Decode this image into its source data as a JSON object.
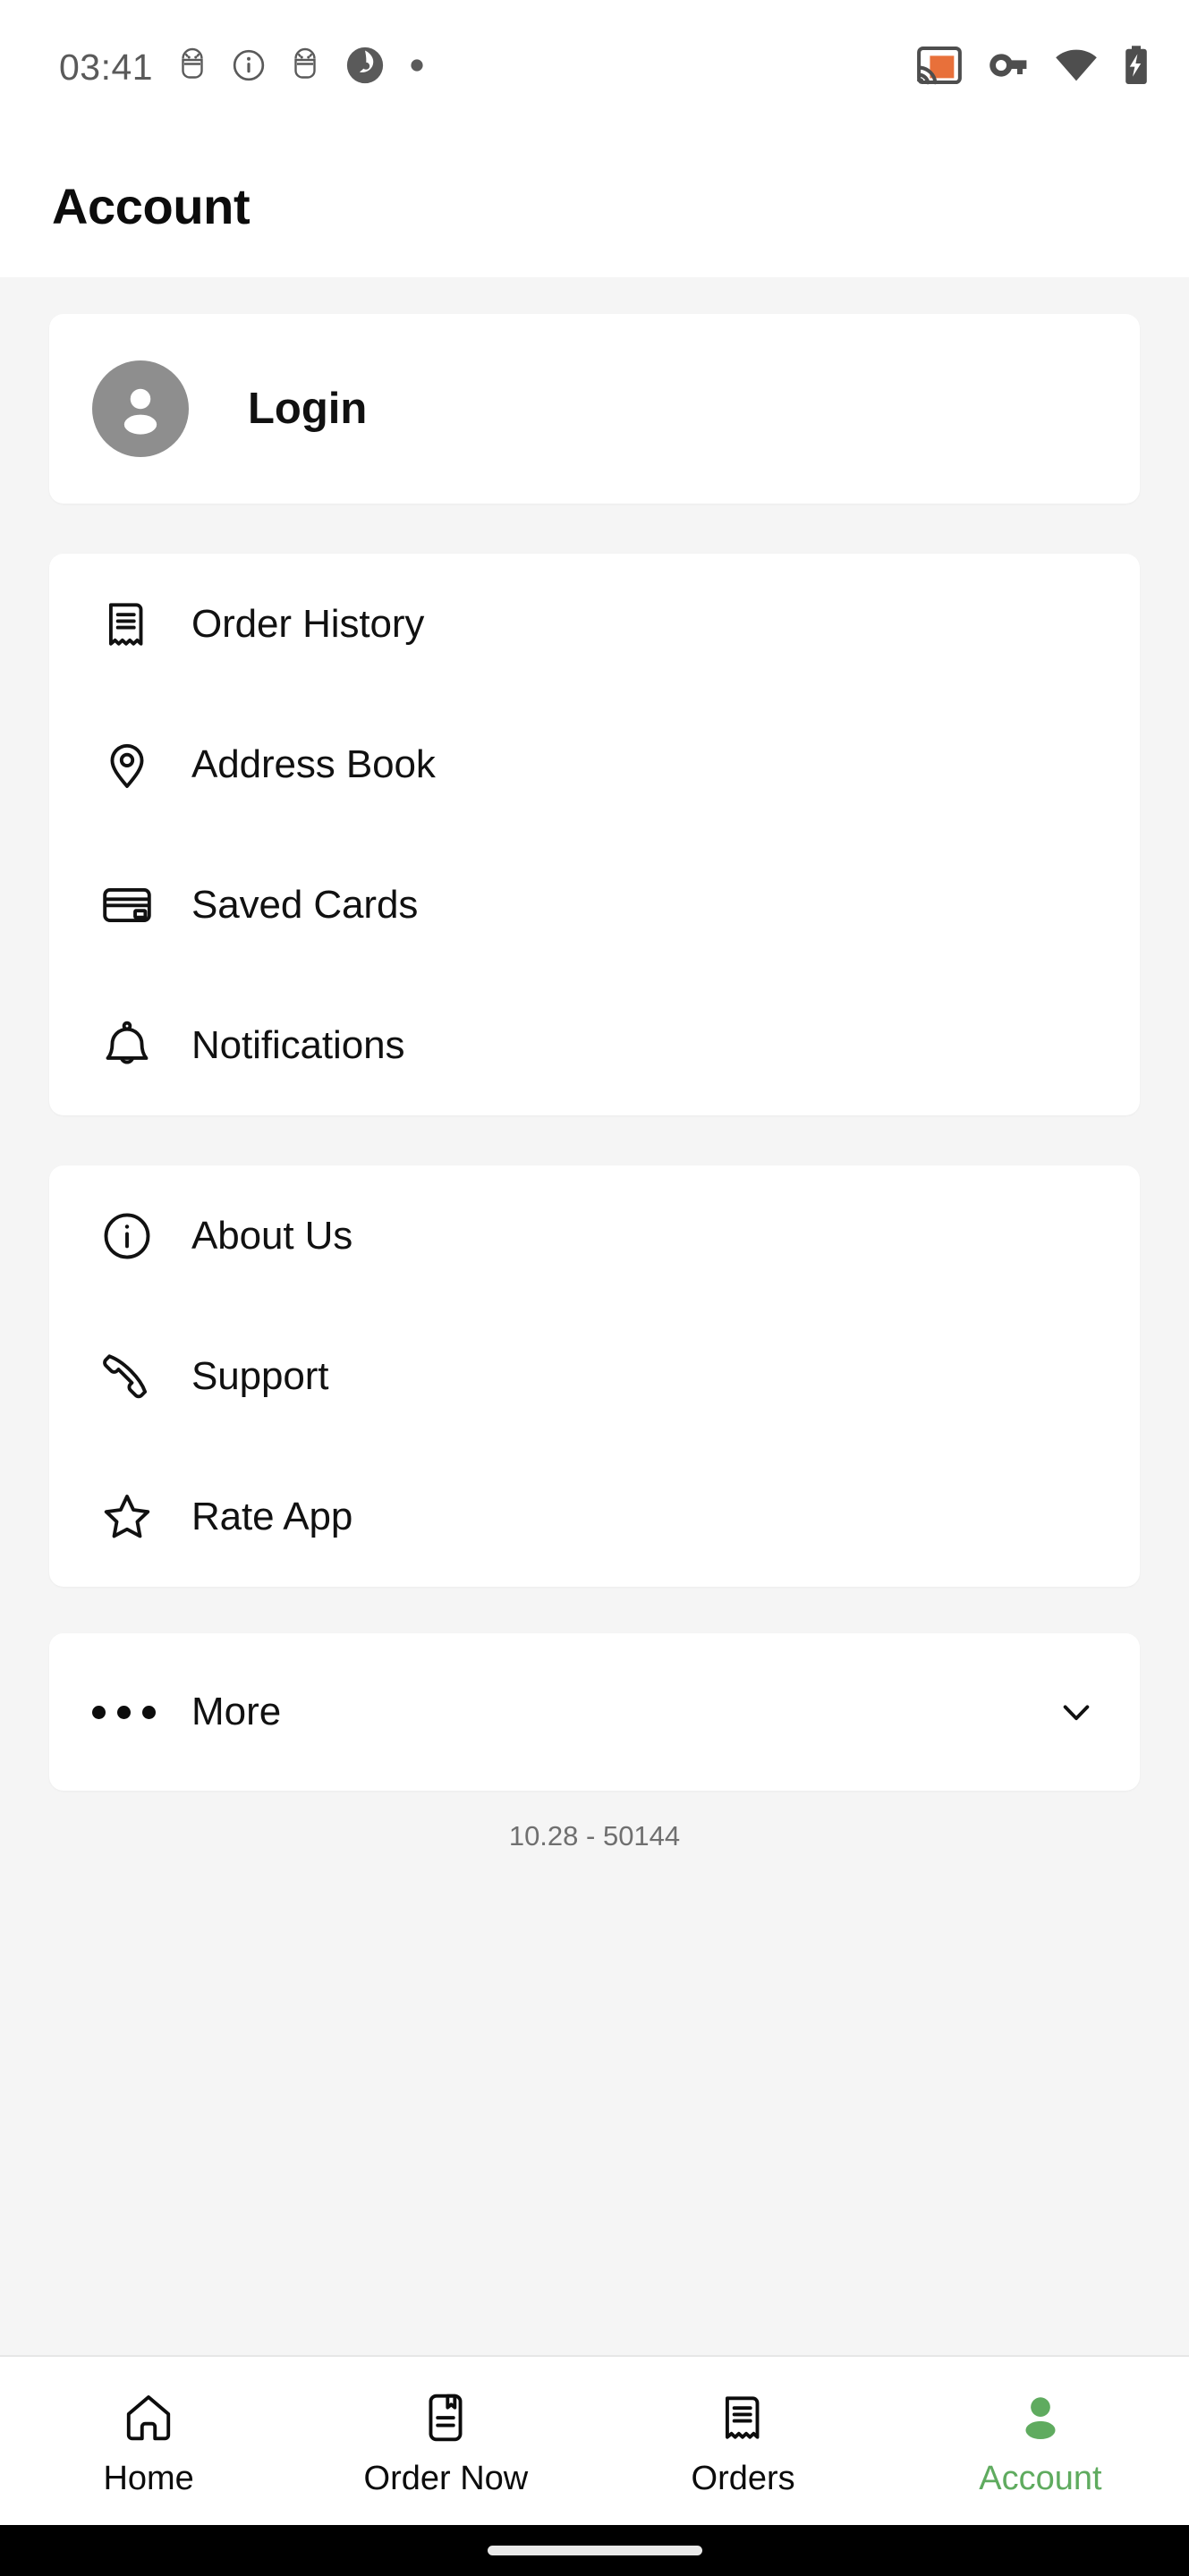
{
  "statusbar": {
    "time": "03:41",
    "left_icons": [
      "android-debug-icon",
      "info-circle-icon",
      "android-debug-icon",
      "app-logo-icon",
      "dot-icon"
    ],
    "right_icons": [
      "cast-icon",
      "vpn-key-icon",
      "wifi-icon",
      "battery-charging-icon"
    ],
    "cast_accent_color": "#e8703a",
    "icon_color": "#5a5a5a"
  },
  "header": {
    "title": "Account"
  },
  "login_card": {
    "label": "Login",
    "avatar_icon": "person-avatar-icon"
  },
  "account_menu": {
    "items": [
      {
        "label": "Order History",
        "icon": "receipt-icon"
      },
      {
        "label": "Address Book",
        "icon": "location-pin-icon"
      },
      {
        "label": "Saved Cards",
        "icon": "credit-card-icon"
      },
      {
        "label": "Notifications",
        "icon": "bell-icon"
      }
    ]
  },
  "info_menu": {
    "items": [
      {
        "label": "About Us",
        "icon": "info-circle-icon"
      },
      {
        "label": "Support",
        "icon": "phone-icon"
      },
      {
        "label": "Rate App",
        "icon": "star-icon"
      }
    ]
  },
  "more_section": {
    "label": "More",
    "leading_icon": "ellipsis-icon",
    "trailing_icon": "chevron-down-icon",
    "expanded": false
  },
  "footer": {
    "version": "10.28 - 50144"
  },
  "bottom_nav": {
    "active_color": "#5fab5f",
    "items": [
      {
        "label": "Home",
        "icon": "home-icon",
        "active": false
      },
      {
        "label": "Order Now",
        "icon": "menu-book-icon",
        "active": false
      },
      {
        "label": "Orders",
        "icon": "receipt-icon",
        "active": false
      },
      {
        "label": "Account",
        "icon": "person-icon",
        "active": true
      }
    ]
  },
  "theme": {
    "page_background": "#f5f5f5",
    "card_background": "#ffffff",
    "text_primary": "#111111",
    "text_muted": "#6f6f6f",
    "accent_green": "#5fab5f"
  }
}
